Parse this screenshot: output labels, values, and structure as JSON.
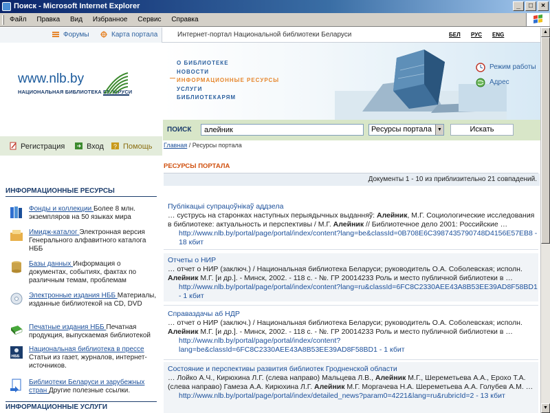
{
  "window": {
    "title": "Поиск - Microsoft Internet Explorer",
    "controls": [
      "_",
      "□",
      "×"
    ]
  },
  "menubar": [
    "Файл",
    "Правка",
    "Вид",
    "Избранное",
    "Сервис",
    "Справка"
  ],
  "topnav": {
    "forums": "Форумы",
    "portal_map": "Карта портала",
    "portal_title": "Интернет-портал Национальной библиотеки Беларуси",
    "langs": [
      "БЕЛ",
      "РУС",
      "ENG"
    ]
  },
  "logo": {
    "url": "www.nlb.by",
    "subtitle": "НАЦИОНАЛЬНАЯ БИБЛИОТЕКА БЕЛАРУСИ"
  },
  "banner_nav": [
    "О БИБЛИОТЕКЕ",
    "НОВОСТИ",
    "ИНФОРМАЦИОННЫЕ РЕСУРСЫ",
    "УСЛУГИ",
    "БИБЛИОТЕКАРЯМ"
  ],
  "banner_side": {
    "hours": "Режим работы",
    "address": "Адрес"
  },
  "auth": {
    "register": "Регистрация",
    "login": "Вход",
    "help": "Помощь"
  },
  "search": {
    "label": "ПОИСК",
    "query": "алейник",
    "scope": "Ресурсы портала",
    "button": "Искать"
  },
  "breadcrumb": {
    "home": "Главная",
    "sep": " / ",
    "current": "Ресурсы портала"
  },
  "section_title": "РЕСУРСЫ ПОРТАЛА",
  "results_count": "Документы 1 - 10 из приблизительно 21 совпадений.",
  "left_resources": {
    "header": "ИНФОРМАЦИОННЫЕ РЕСУРСЫ",
    "items": [
      {
        "link": "Фонды и коллекции ",
        "text": "Более 8 млн. экземпляров на 50 языках мира"
      },
      {
        "link": "Имидж-каталог ",
        "text": "Электронная версия Генерального алфавитного каталога НББ"
      },
      {
        "link": "Базы данных ",
        "text": "Информация о документах, событиях, фактах по различным темам, проблемам"
      },
      {
        "link": "Электронные издания НББ ",
        "text": "Материалы, изданные библиотекой на CD, DVD"
      },
      {
        "link": "Печатные издания НББ ",
        "text": "Печатная продукция, выпускаемая библиотекой"
      },
      {
        "link": "Национальная библиотека в прессе ",
        "text": "Статьи из газет, журналов, интернет-источников."
      },
      {
        "link": "Библиотеки Беларуси и зарубежных стран ",
        "text": "Другие полезные ссылки."
      }
    ],
    "icon_caption": "НББ"
  },
  "services_header": "ИНФОРМАЦИОННЫЕ УСЛУГИ",
  "results": [
    {
      "title": "Публікацыі супрацоўнікаў аддзела",
      "snippet": [
        [
          "… суструсь на старонках наступных перыядычных выданняў: ",
          false
        ],
        [
          "Алейник",
          true
        ],
        [
          ", М.Г. Социологические исследования в библиотеке: актуальность и перспективы / М.Г. ",
          false
        ],
        [
          "Алейник",
          true
        ],
        [
          " // Библиотечное дело 2001: Российские …",
          false
        ]
      ],
      "url": "http://www.nlb.by/portal/page/portal/index/content?lang=be&classId=0B708E6C3987435790748D4156E57EB8",
      "size": " - 18 кбит"
    },
    {
      "title": "Отчеты о НИР",
      "snippet": [
        [
          "… отчет о НИР (заключ.) / Национальная библиотека Беларуси; руководитель О.А. Соболевская; исполн. ",
          false
        ],
        [
          "Алейник",
          true
        ],
        [
          " М.Г. [и др.]. - Минск, 2002. - 118 с. - №. ГР 20014233 Роль и место публичной библиотеки в …",
          false
        ]
      ],
      "url": "http://www.nlb.by/portal/page/portal/index/content?lang=ru&classId=6FC8C2330AEE43A8B53EE39AD8F58BD1",
      "size": " - 1 кбит"
    },
    {
      "title": "Справаздачы аб НДР",
      "snippet": [
        [
          "… отчет о НИР (заключ.) / Национальная библиотека Беларуси; руководитель О.А. Соболевская; исполн. ",
          false
        ],
        [
          "Алейник",
          true
        ],
        [
          " М.Г. [и др.]. - Минск, 2002. - 118 с. - №. ГР 20014233 Роль и место публичной библиотеки в …",
          false
        ]
      ],
      "url": "http://www.nlb.by/portal/page/portal/index/content?lang=be&classId=6FC8C2330AEE43A8B53EE39AD8F58BD1",
      "size": " - 1 кбит"
    },
    {
      "title": "Состояние и перспективы развития библиотек Гродненской области",
      "snippet": [
        [
          "… Лойко А.Ч., Кирюхина Л.Г. (слева направо) Мальцева Л.В., ",
          false
        ],
        [
          "Алейник",
          true
        ],
        [
          " М.Г., Шереметьева А.А., Ерохо Т.А. (слева направо) Гамеза А.А. Кирюхина Л.Г. ",
          false
        ],
        [
          "Алейник",
          true
        ],
        [
          " М.Г. Моргачева Н.А. Шереметьева А.А. Голубев А.М. …",
          false
        ]
      ],
      "url": "http://www.nlb.by/portal/page/portal/index/detailed_news?param0=4221&lang=ru&rubricId=2",
      "size": " - 13 кбит"
    }
  ],
  "colors": {
    "title_gradient_start": "#0a246a",
    "link_blue": "#1b4f9a",
    "nav_orange": "#e6862c",
    "section_title": "#d0500f",
    "searchbar_green": "#d8e6c8",
    "authbar_green": "#e3ecdb"
  },
  "icons": {
    "title": "ie-icon",
    "windows_logo": "windows-flag-icon",
    "forums": "forum-icon",
    "map": "portal-map-icon",
    "hours": "clock-icon",
    "address": "globe-icon",
    "register": "register-icon",
    "login": "login-icon",
    "help": "help-icon"
  }
}
